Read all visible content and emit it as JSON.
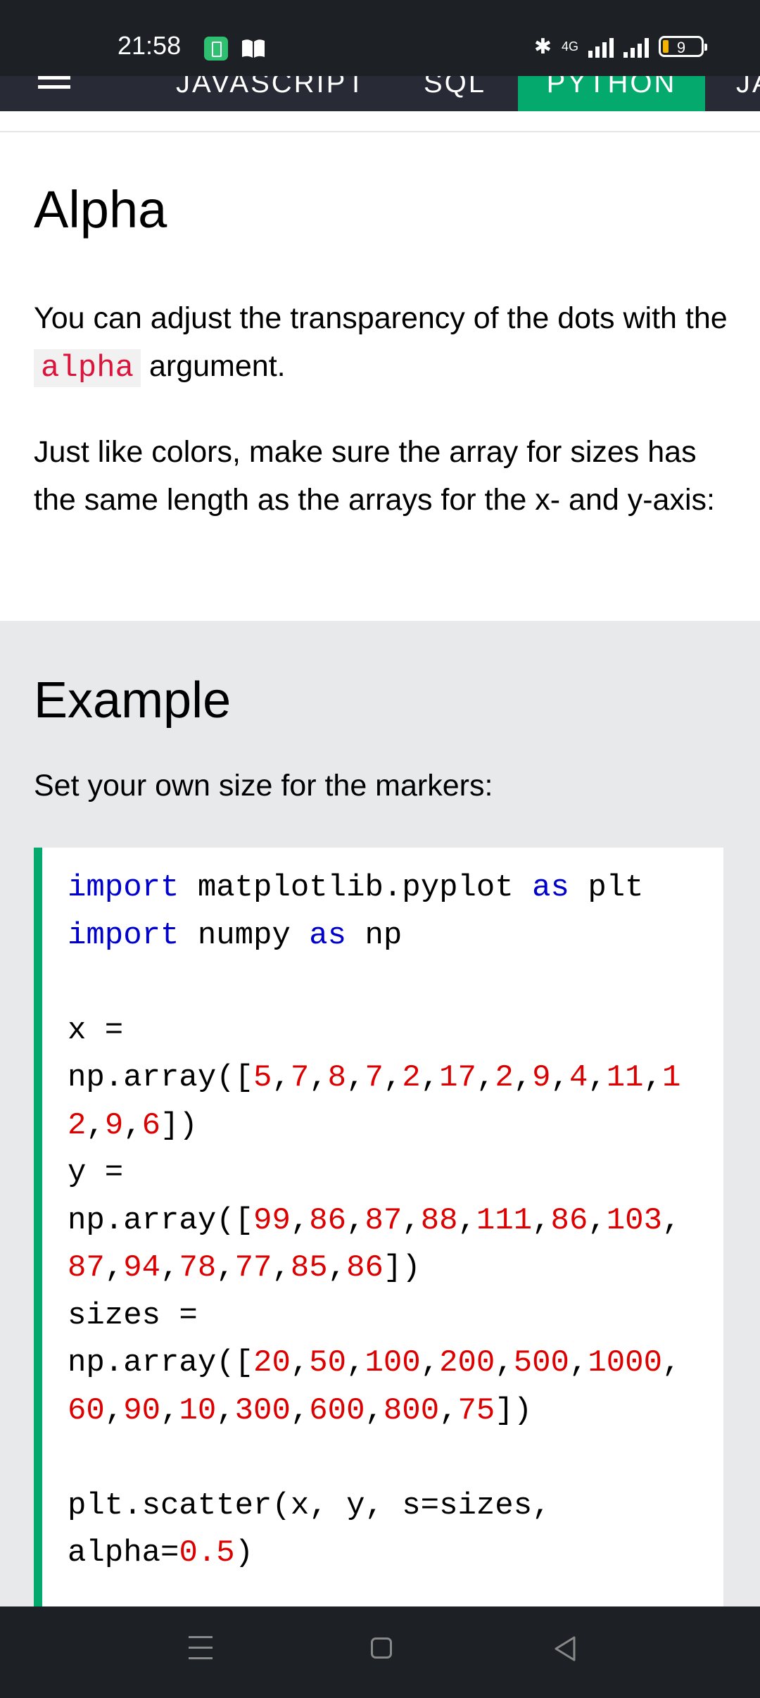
{
  "status_bar": {
    "time": "21:58",
    "network": "4G",
    "battery": "9"
  },
  "nav": {
    "tabs": [
      "JAVASCRIPT",
      "SQL",
      "PYTHON",
      "JA"
    ]
  },
  "content": {
    "heading": "Alpha",
    "para1_before": "You can adjust the transparency of the dots with the ",
    "para1_code": "alpha",
    "para1_after": " argument.",
    "para2": "Just like colors, make sure the array for sizes has the same length as the arrays for the x- and y-axis:"
  },
  "example": {
    "title": "Example",
    "description": "Set your own size for the markers:",
    "code": {
      "kw_import": "import",
      "kw_as": "as",
      "mod_mpl": "matplotlib.pyplot",
      "alias_plt": "plt",
      "mod_np": "numpy",
      "alias_np": "np",
      "x_assign": "x =",
      "y_assign": "y =",
      "sizes_assign": "sizes =",
      "np_array_open": "np.array([",
      "close": "])",
      "x_values_line1": [
        "5",
        "7",
        "8",
        "7",
        "2",
        "17",
        "2",
        "9",
        "4",
        "11",
        "1"
      ],
      "x_values_line2": [
        "2",
        "9",
        "6"
      ],
      "y_values_line1": [
        "99",
        "86",
        "87",
        "88",
        "111",
        "86",
        "103"
      ],
      "y_values_line2": [
        "87",
        "94",
        "78",
        "77",
        "85",
        "86"
      ],
      "sizes_values_line1": [
        "20",
        "50",
        "100",
        "200",
        "500",
        "1000"
      ],
      "sizes_values_line2": [
        "60",
        "90",
        "10",
        "300",
        "600",
        "800",
        "75"
      ],
      "scatter_line1": "plt.scatter(x, y, s=sizes,",
      "scatter_line2_prefix": "alpha=",
      "alpha_value": "0.5",
      "scatter_line2_suffix": ")"
    }
  },
  "colors": {
    "accent": "#04aa6d",
    "keyword": "#0000cd",
    "number": "#dd0000",
    "inline_code": "#dc143c"
  },
  "icons": [
    "battery-saver-icon",
    "book-icon",
    "bluetooth-icon",
    "signal-icon",
    "battery-icon",
    "hamburger-icon",
    "menu-icon",
    "home-icon",
    "back-icon"
  ]
}
